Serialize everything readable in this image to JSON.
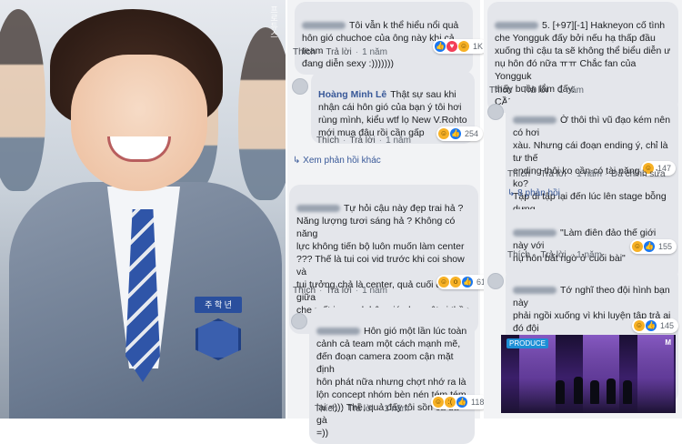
{
  "photo": {
    "nametag": "주 학 년",
    "watermark": "프로듀스"
  },
  "middle": {
    "c1": {
      "text": "Tôi vẫn k thể hiểu nổi quả\nhôn gió chuchoe của ông này khi cả team\nđang diễn sexy :)))))))",
      "like": "Thích",
      "reply": "Trả lời",
      "time": "1 năm",
      "count": "1K"
    },
    "c2": {
      "name": "Hoàng Minh Lê",
      "text": "Thật sự sau khi\nnhận cái hôn gió của bạn ý tôi hơi\nrùng mình, kiểu wtf lọ New V.Rohto\nmới mua đâu rồi cần gấp",
      "like": "Thích",
      "reply": "Trả lời",
      "time": "1 năm",
      "count": "254"
    },
    "more": "Xem phản hồi khác",
    "c3": {
      "text": "Tự hỏi cậu này đẹp trai hả ?\nNăng lượng tươi sáng hả ? Không có năng\nlực không tiến bộ luôn muốn làm center\n??? Thế là tui coi vid trước khi coi show và\ntui tưởng chả là center, quả cuối đứng giữa\nche mất jongguk hôn gió như một vị thần\n😊",
      "like": "Thích",
      "reply": "Trả lời",
      "time": "1 năm",
      "count": "613"
    },
    "c4": {
      "text": "Hôn gió một lần lúc toàn\ncảnh cả team một cách mạnh mẽ,\nđến đoạn camera zoom cận mặt định\nhôn phát nữa nhưng chợt nhớ ra là\nlộn concept nhóm bèn nén tém tém\nlại =))) Thề, quả đấy tôi sồn cả da gà\n=))",
      "like": "Thích",
      "reply": "Trả lời",
      "time": "1 năm",
      "count": "118"
    }
  },
  "right": {
    "c1": {
      "text": "5. [+97][-1] Hakneyon cố tình\nche Yongguk đấy bởi nếu hạ thấp đầu\nxuống thì cậu ta sẽ không thể biểu diễn ư\nnụ hôn đó nữa ㅠㅠ Chắc fan của Yongguk\nthấy buồn lắm đấy.\nCẦN CMN LỜI",
      "like": "Thích",
      "reply": "Trả lời",
      "time": "1 năm"
    },
    "c2": {
      "text": "Ờ thôi thì vũ đạo kém nên có hơi\nxàu. Nhưng cái đoạn ending ý, chỉ là tư thế\nending thôi ko cần có tài năng gì phải ko?\nTập đi tập lại đến lúc lên stage bỗng dưng\nquên hay sao mà che cmn mất center, có ý\ngì y nhỉ?",
      "like": "Thích",
      "reply": "Trả lời",
      "time": "1 năm",
      "edited": "Đã chỉnh sửa",
      "count": "147"
    },
    "more": "8 phản hồi",
    "c3": {
      "text": "\"Làm điên đảo thế giới này với\nnụ hôn bất ngờ ở cuối bài\"\nHay là điên tiết ? =)))))))))))",
      "like": "Thích",
      "reply": "Trả lời",
      "time": "1 năm",
      "count": "155"
    },
    "c4": {
      "text": "Tớ nghĩ theo đội hình bạn này\nphải ngồi xuống vì khi luyện tập trả ai đó đội\nhình che mất center. Chắc ending hứng\nquá nên thay vì ngồi mà bạn chuyển mẹ n\nsang đứng luôn. Hay vch",
      "like": "Thích",
      "reply": "Trả lời",
      "time": "1 năm",
      "count": "145"
    },
    "video": {
      "logo": "PRODUCE",
      "channel": "M"
    }
  }
}
